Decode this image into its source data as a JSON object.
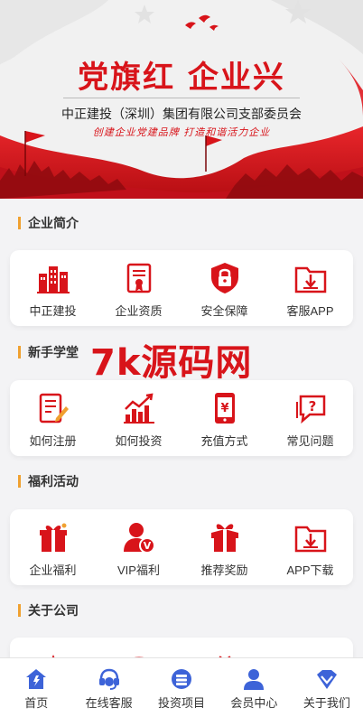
{
  "banner": {
    "title": "党旗红 企业兴",
    "subtitle": "中正建投（深圳）集团有限公司支部委员会",
    "slogan": "创建企业党建品牌  打造和谐活力企业"
  },
  "watermark": "7k源码网",
  "sections": [
    {
      "title": "企业简介",
      "items": [
        {
          "label": "中正建投",
          "icon": "buildings-icon"
        },
        {
          "label": "企业资质",
          "icon": "certificate-icon"
        },
        {
          "label": "安全保障",
          "icon": "shield-lock-icon"
        },
        {
          "label": "客服APP",
          "icon": "download-folder-icon"
        }
      ]
    },
    {
      "title": "新手学堂",
      "items": [
        {
          "label": "如何注册",
          "icon": "register-form-icon"
        },
        {
          "label": "如何投资",
          "icon": "chart-up-icon"
        },
        {
          "label": "充值方式",
          "icon": "phone-yuan-icon"
        },
        {
          "label": "常见问题",
          "icon": "question-bubble-icon"
        }
      ]
    },
    {
      "title": "福利活动",
      "items": [
        {
          "label": "企业福利",
          "icon": "gift-box-icon"
        },
        {
          "label": "VIP福利",
          "icon": "vip-user-icon"
        },
        {
          "label": "推荐奖励",
          "icon": "reward-box-icon"
        },
        {
          "label": "APP下载",
          "icon": "app-download-icon"
        }
      ]
    },
    {
      "title": "关于公司",
      "items": []
    }
  ],
  "tabbar": [
    {
      "label": "首页",
      "icon": "home-icon"
    },
    {
      "label": "在线客服",
      "icon": "customer-service-icon"
    },
    {
      "label": "投资项目",
      "icon": "investment-icon"
    },
    {
      "label": "会员中心",
      "icon": "member-icon"
    },
    {
      "label": "关于我们",
      "icon": "about-heart-icon"
    }
  ],
  "colors": {
    "accent_red": "#d8141a",
    "section_bar": "#f0a030",
    "tab_blue": "#3d63d8"
  }
}
